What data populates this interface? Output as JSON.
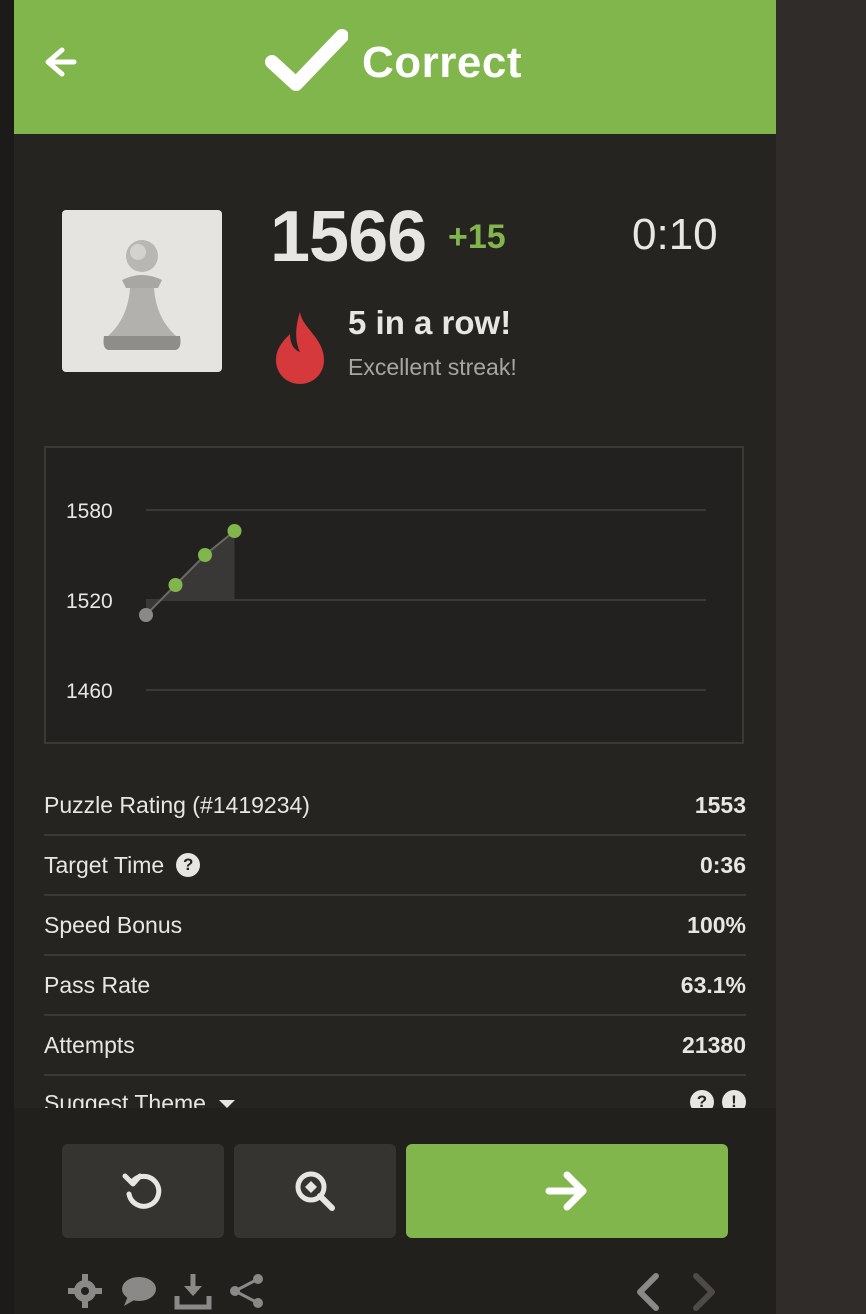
{
  "header": {
    "title": "Correct",
    "icons": [
      "back-arrow-icon",
      "checkmark-icon"
    ],
    "color": "#81b64c"
  },
  "player": {
    "avatar_icon": "pawn-icon",
    "rating": "1566",
    "rating_delta": "+15",
    "timer": "0:10"
  },
  "streak": {
    "icon": "flame-icon",
    "title": "5 in a row!",
    "subtitle": "Excellent streak!"
  },
  "chart_data": {
    "type": "line",
    "yticks": [
      "1580",
      "1520",
      "1460"
    ],
    "ylim": [
      1460,
      1580
    ],
    "values": [
      1510,
      1530,
      1550,
      1566
    ],
    "point_colors": [
      "#8b8987",
      "#81b64c",
      "#81b64c",
      "#81b64c"
    ],
    "grid": true
  },
  "stats": [
    {
      "label": "Puzzle Rating (#1419234)",
      "value": "1553"
    },
    {
      "label": "Target Time",
      "value": "0:36",
      "help_icon": "question-icon"
    },
    {
      "label": "Speed Bonus",
      "value": "100%"
    },
    {
      "label": "Pass Rate",
      "value": "63.1%"
    },
    {
      "label": "Attempts",
      "value": "21380"
    }
  ],
  "suggest": {
    "label": "Suggest Theme",
    "icons": [
      "chevron-down-icon",
      "question-icon",
      "info-icon"
    ]
  },
  "actions": {
    "retry_icon": "retry-icon",
    "analysis_icon": "magnify-analysis-icon",
    "next_icon": "arrow-right-icon"
  },
  "footer": {
    "icons": [
      "gear-icon",
      "chat-icon",
      "download-icon",
      "share-icon"
    ],
    "nav": [
      "chevron-left-icon",
      "chevron-right-icon"
    ]
  }
}
